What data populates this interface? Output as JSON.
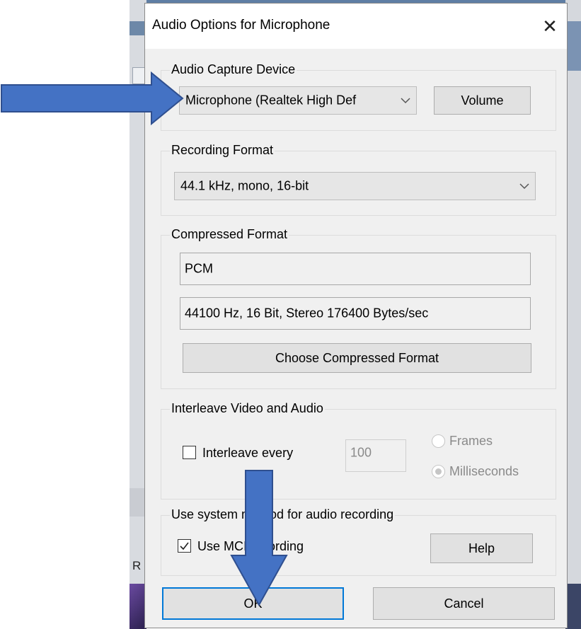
{
  "dialog": {
    "title": "Audio Options for Microphone",
    "close_glyph": "✕"
  },
  "capture": {
    "group_label": "Audio Capture Device",
    "device_value": "Microphone (Realtek High Def",
    "volume_label": "Volume"
  },
  "recording": {
    "group_label": "Recording Format",
    "format_value": "44.1 kHz, mono, 16-bit"
  },
  "compressed": {
    "group_label": "Compressed Format",
    "codec_value": "PCM",
    "details_value": "44100 Hz, 16 Bit, Stereo 176400 Bytes/sec",
    "choose_label": "Choose  Compressed Format"
  },
  "interleave": {
    "group_label": "Interleave Video and Audio",
    "checkbox_label": "Interleave every",
    "checked": false,
    "value": "100",
    "options": [
      "Frames",
      "Milliseconds"
    ],
    "selected_option": "Milliseconds"
  },
  "system": {
    "group_label": "Use system method for audio recording",
    "checkbox_label": "Use MCI recording",
    "checked": true,
    "help_label": "Help"
  },
  "footer": {
    "ok_label": "OK",
    "cancel_label": "Cancel"
  },
  "background": {
    "partial_letter": "R"
  },
  "colors": {
    "annotation_arrow_fill": "#4472c4",
    "annotation_arrow_stroke": "#2f4f8f",
    "default_button_border": "#0078d7"
  },
  "icons": {
    "close": "close-icon",
    "dropdown": "chevron-down-icon",
    "annotation": "arrow-annotation"
  }
}
